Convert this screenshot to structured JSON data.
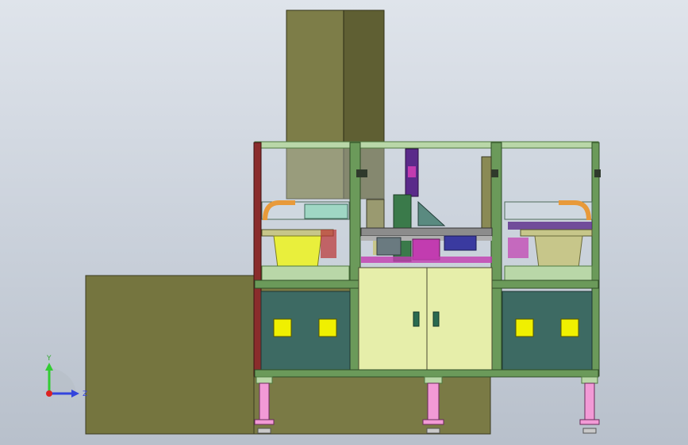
{
  "view": {
    "background_top": "#dfe4eb",
    "background_bottom": "#b8c0cb"
  },
  "colors": {
    "olive_block": "#7a7a45",
    "olive_dark": "#5f5f33",
    "frame_green": "#6b9a5a",
    "frame_light": "#b9d7a8",
    "cabinet_teal": "#3d6a63",
    "door_cream": "#e6eeaa",
    "indicator_yellow": "#f0f000",
    "bowl_yellow": "#e9ef3c",
    "bowl_khaki": "#c7c68a",
    "leg_pink": "#f29ad6",
    "accent_magenta": "#c23cb0",
    "accent_purple": "#5a2a8a",
    "accent_blue": "#3a3aa0",
    "accent_red": "#b33",
    "track_gray": "#8c8c8c"
  },
  "triad": {
    "y_label": "Y",
    "z_label": "Z",
    "y_color": "#33cc33",
    "z_color": "#3344dd",
    "origin_color": "#dd2222",
    "icon": "coordinate-triad-icon"
  }
}
